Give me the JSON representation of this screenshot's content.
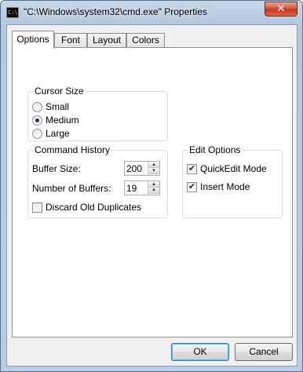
{
  "window": {
    "title": "\"C:\\Windows\\system32\\cmd.exe\" Properties",
    "icon_text": "C:\\",
    "close_label": "✕"
  },
  "tabs": [
    {
      "label": "Options",
      "active": true
    },
    {
      "label": "Font",
      "active": false
    },
    {
      "label": "Layout",
      "active": false
    },
    {
      "label": "Colors",
      "active": false
    }
  ],
  "cursor_size": {
    "title": "Cursor Size",
    "options": [
      {
        "label": "Small",
        "checked": false
      },
      {
        "label": "Medium",
        "checked": true
      },
      {
        "label": "Large",
        "checked": false
      }
    ]
  },
  "command_history": {
    "title": "Command History",
    "buffer_size_label": "Buffer Size:",
    "buffer_size_value": "200",
    "number_of_buffers_label": "Number of Buffers:",
    "number_of_buffers_value": "19",
    "discard_label": "Discard Old Duplicates",
    "discard_checked": false
  },
  "edit_options": {
    "title": "Edit Options",
    "quickedit_label": "QuickEdit Mode",
    "quickedit_checked": true,
    "insert_label": "Insert Mode",
    "insert_checked": true
  },
  "buttons": {
    "ok": "OK",
    "cancel": "Cancel"
  },
  "icons": {
    "check": "✔",
    "spin_up": "▲",
    "spin_down": "▼"
  }
}
